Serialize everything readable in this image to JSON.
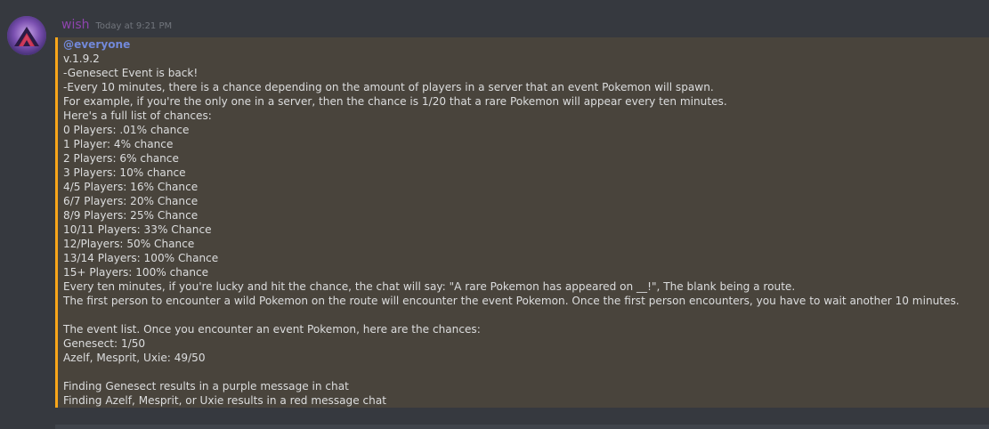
{
  "message": {
    "author": "wish",
    "timestamp": "Today at 9:21 PM",
    "author_color": "#8e44ad",
    "highlight_color": "#faa61a",
    "mention": "@everyone",
    "lines": [
      "v.1.9.2",
      "-Genesect Event is back!",
      "-Every 10 minutes, there is a chance depending on the amount of players in a server that an event Pokemon will spawn.",
      "For example, if you're the only one in a server, then the chance is 1/20 that a rare Pokemon will appear every ten minutes.",
      "Here's a full list of chances:",
      "0 Players: .01% chance",
      "1 Player: 4% chance",
      "2 Players: 6% chance",
      "3 Players: 10% chance",
      "4/5 Players: 16% Chance",
      "6/7 Players: 20% Chance",
      "8/9 Players: 25% Chance",
      "10/11 Players: 33% Chance",
      "12/Players: 50% Chance",
      "13/14 Players: 100% Chance",
      "15+ Players: 100% chance",
      "Every ten minutes, if you're lucky and hit the chance, the chat will say: \"A rare Pokemon has appeared on __!\", The blank being a route.",
      "The first person to encounter a wild Pokemon on the route will encounter the event Pokemon. Once the first person encounters, you have to wait another 10 minutes.",
      "",
      "The event list. Once you encounter an event Pokemon, here are the chances:",
      "Genesect: 1/50",
      "Azelf, Mesprit, Uxie: 49/50",
      "",
      "Finding Genesect results in a purple message in chat",
      "Finding Azelf, Mesprit, or Uxie results in a red message chat"
    ]
  }
}
